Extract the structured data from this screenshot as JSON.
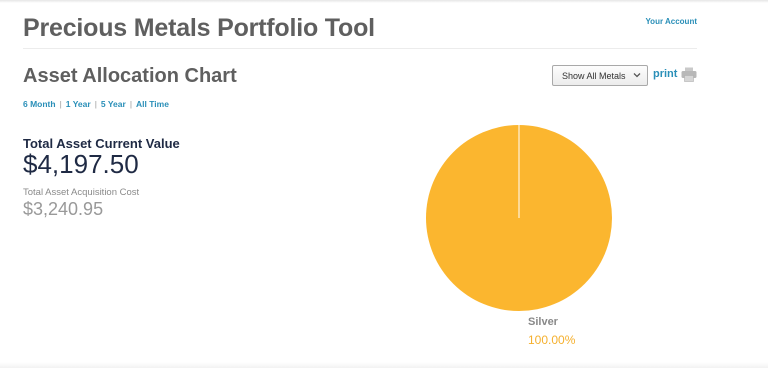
{
  "header": {
    "title": "Precious Metals Portfolio Tool",
    "account_link": "Your Account"
  },
  "section": {
    "title": "Asset Allocation Chart",
    "ranges": [
      "6 Month",
      "1 Year",
      "5 Year",
      "All Time"
    ],
    "range_separator": "|"
  },
  "toolbar": {
    "metal_select_value": "Show All Metals",
    "print_label": "print",
    "print_icon": "printer-icon",
    "dropdown_icon": "chevron-down-icon"
  },
  "summary": {
    "current_label": "Total Asset Current Value",
    "current_value": "$4,197.50",
    "acquisition_label": "Total Asset Acquisition Cost",
    "acquisition_value": "$3,240.95"
  },
  "colors": {
    "accent_link": "#2a8fb8",
    "silver_slice": "#fbb62f",
    "title_text": "#5f5f5f",
    "value_text": "#1f2a44"
  },
  "chart_data": {
    "type": "pie",
    "categories": [
      "Silver"
    ],
    "values": [
      100.0
    ],
    "labels": [
      "100.00%"
    ],
    "colors": [
      "#fbb62f"
    ]
  }
}
